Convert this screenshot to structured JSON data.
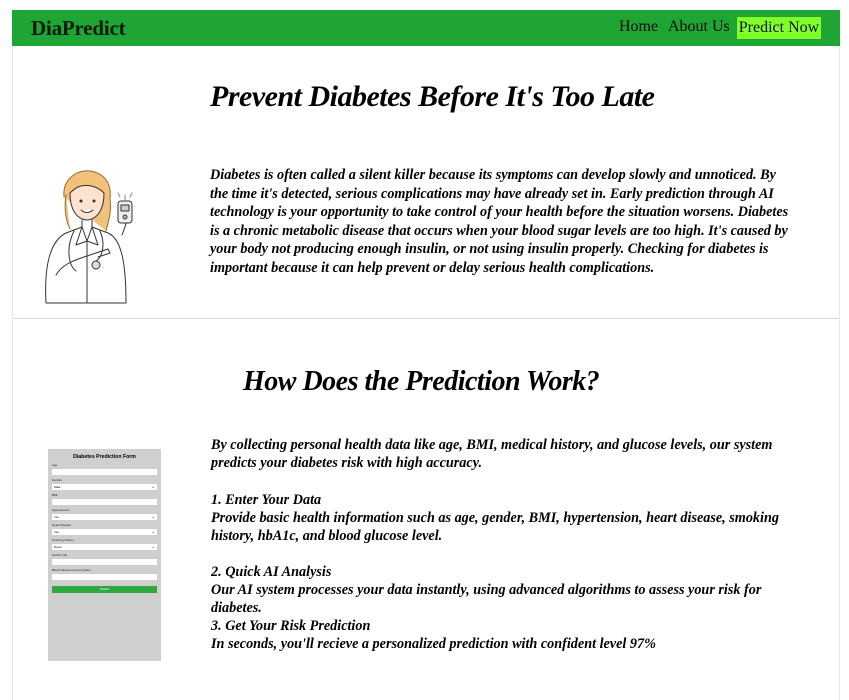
{
  "header": {
    "brand": "DiaPredict",
    "nav": {
      "home": "Home",
      "about": "About Us",
      "predict": "Predict Now"
    }
  },
  "hero": {
    "title": "Prevent Diabetes Before It's Too Late",
    "paragraph": "Diabetes is often called a silent killer because its symptoms can develop slowly and unnoticed. By the time it's detected, serious complications may have already set in. Early prediction through AI technology is your opportunity to take control of your health before the situation worsens. Diabetes is a chronic metabolic disease that occurs when your blood sugar levels are too high. It's caused by your body not producing enough insulin, or not using insulin properly. Checking for diabetes is important because it can help prevent or delay serious health complications."
  },
  "how": {
    "title": "How Does the Prediction Work?",
    "intro": "By collecting personal health data like age, BMI, medical history, and glucose levels, our system predicts your diabetes risk with high accuracy.",
    "steps": [
      {
        "title": "1. Enter Your Data",
        "text": "Provide basic health information such as age, gender, BMI, hypertension, heart disease, smoking history, hbA1c, and blood glucose level."
      },
      {
        "title": "2. Quick AI Analysis",
        "text": "Our AI system processes your data instantly, using advanced algorithms to assess your risk for diabetes."
      },
      {
        "title": "3. Get Your Risk Prediction",
        "text": "In seconds, you'll recieve a personalized prediction with confident level 97%"
      }
    ]
  },
  "form_preview": {
    "title": "Diabetes Prediction Form",
    "fields": [
      {
        "label": "Age",
        "type": "input",
        "value": ""
      },
      {
        "label": "Gender",
        "type": "select",
        "value": "Male"
      },
      {
        "label": "BMI",
        "type": "input",
        "value": ""
      },
      {
        "label": "Hypertension",
        "type": "select",
        "value": "Yes"
      },
      {
        "label": "Heart Disease",
        "type": "select",
        "value": "Yes"
      },
      {
        "label": "Smoking History",
        "type": "select",
        "value": "Never"
      },
      {
        "label": "HbA1C (%)",
        "type": "input",
        "value": ""
      },
      {
        "label": "Blood Glucose Level (mg/dL)",
        "type": "input",
        "value": ""
      }
    ],
    "submit": "Predict"
  },
  "colors": {
    "navbar": "#1ea534",
    "predict_button": "#7fff2a",
    "form_submit": "#2ea83f",
    "form_bg": "#cfcfcf"
  },
  "icons": {
    "doctor_illustration": "doctor-with-glucose-meter-illustration"
  }
}
